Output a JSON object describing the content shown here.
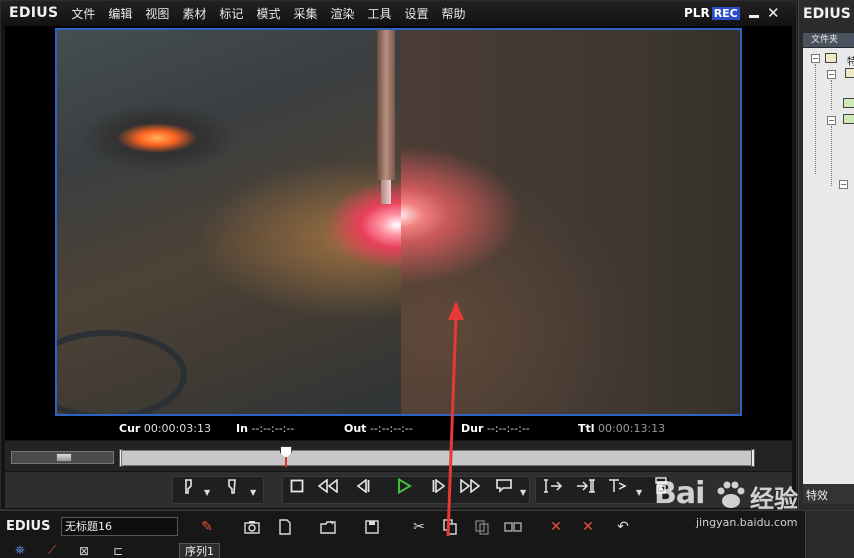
{
  "menubar": {
    "logo": "EDIUS",
    "items": [
      "文件",
      "编辑",
      "视图",
      "素材",
      "标记",
      "模式",
      "采集",
      "渲染",
      "工具",
      "设置",
      "帮助"
    ],
    "plr": "PLR",
    "rec": "REC"
  },
  "timecodes": {
    "cur_label": "Cur",
    "cur_value": "00:00:03:13",
    "in_label": "In",
    "in_value": "--:--:--:--",
    "out_label": "Out",
    "out_value": "--:--:--:--",
    "dur_label": "Dur",
    "dur_value": "--:--:--:--",
    "ttl_label": "Ttl",
    "ttl_value": "00:00:13:13"
  },
  "scrub": {
    "playhead_fraction": 0.26
  },
  "transport": {
    "icons": [
      "set-in-icon",
      "set-out-icon",
      "stop-icon",
      "rewind-icon",
      "step-back-icon",
      "play-icon",
      "step-forward-icon",
      "fast-forward-icon",
      "loop-icon",
      "insert-icon",
      "overwrite-icon",
      "replace-icon",
      "export-icon"
    ],
    "accent": "#3fbf3f"
  },
  "bin": {
    "logo": "EDIUS",
    "folder_header": "文件夹",
    "tree_label": "特",
    "effects_tab": "特效"
  },
  "timeline": {
    "logo": "EDIUS",
    "project_name": "无标题16",
    "sequence_tab": "序列1"
  },
  "watermark": {
    "brand": "Bai",
    "brand_cn": "经验",
    "url": "jingyan.baidu.com"
  },
  "annotation": {
    "color": "#e53935"
  }
}
